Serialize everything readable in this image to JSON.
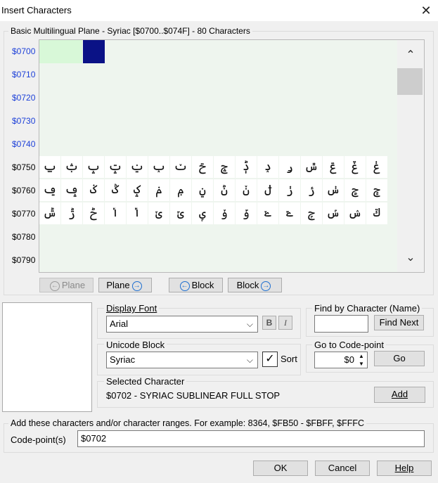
{
  "window": {
    "title": "Insert Characters",
    "close_glyph": "✕"
  },
  "charset_group": {
    "label": "Basic Multilingual Plane - Syriac [$0700..$074F] - 80 Characters",
    "row_labels": [
      "$0700",
      "$0710",
      "$0720",
      "$0730",
      "$0740",
      "$0750",
      "$0760",
      "$0770",
      "$0780",
      "$0790"
    ],
    "rows": [
      [
        "ݐ",
        "ݑ",
        "ݒ",
        "ݓ",
        "ݔ",
        "ݕ",
        "ݖ",
        "ݗ",
        "ݘ",
        "ݙ",
        "ݚ",
        "ݛ",
        "ݜ",
        "ݝ",
        "ݞ",
        "ݟ"
      ],
      [
        "ݠ",
        "ݡ",
        "ݢ",
        "ݣ",
        "ݤ",
        "ݥ",
        "ݦ",
        "ݧ",
        "ݨ",
        "ݩ",
        "ݪ",
        "ݫ",
        "ݬ",
        "ݭ",
        "ݮ",
        "ݯ"
      ],
      [
        "ݰ",
        "ݱ",
        "ݲ",
        "ݳ",
        "ݴ",
        "ݵ",
        "ݶ",
        "ݷ",
        "ݸ",
        "ݹ",
        "ݺ",
        "ݻ",
        "ݼ",
        "ݽ",
        "ݾ",
        "ݿ"
      ]
    ],
    "scroll_up_glyph": "⌃",
    "scroll_down_glyph": "⌄"
  },
  "nav": {
    "plane_prev": "Plane",
    "plane_next": "Plane",
    "block_prev": "Block",
    "block_next": "Block",
    "prev_glyph": "←",
    "next_glyph": "→"
  },
  "display_font": {
    "label": "Display Font",
    "value": "Arial",
    "bold": "B",
    "italic": "I"
  },
  "unicode_block": {
    "label": "Unicode Block",
    "value": "Syriac",
    "sort_label": "Sort",
    "sort_checked_glyph": "✓"
  },
  "find": {
    "label": "Find by Character (Name)",
    "value": "",
    "button": "Find Next"
  },
  "goto": {
    "label": "Go to Code-point",
    "value": "$0",
    "button": "Go"
  },
  "selected": {
    "label": "Selected Character",
    "value": "$0702 - SYRIAC SUBLINEAR FULL STOP",
    "add_button": "Add"
  },
  "add_group": {
    "label": "Add these characters and/or character ranges. For example: 8364, $FB50 - $FBFF, $FFFC",
    "codepoints_label": "Code-point(s)",
    "codepoints_value": "$0702"
  },
  "footer": {
    "ok": "OK",
    "cancel": "Cancel",
    "help": "Help"
  }
}
